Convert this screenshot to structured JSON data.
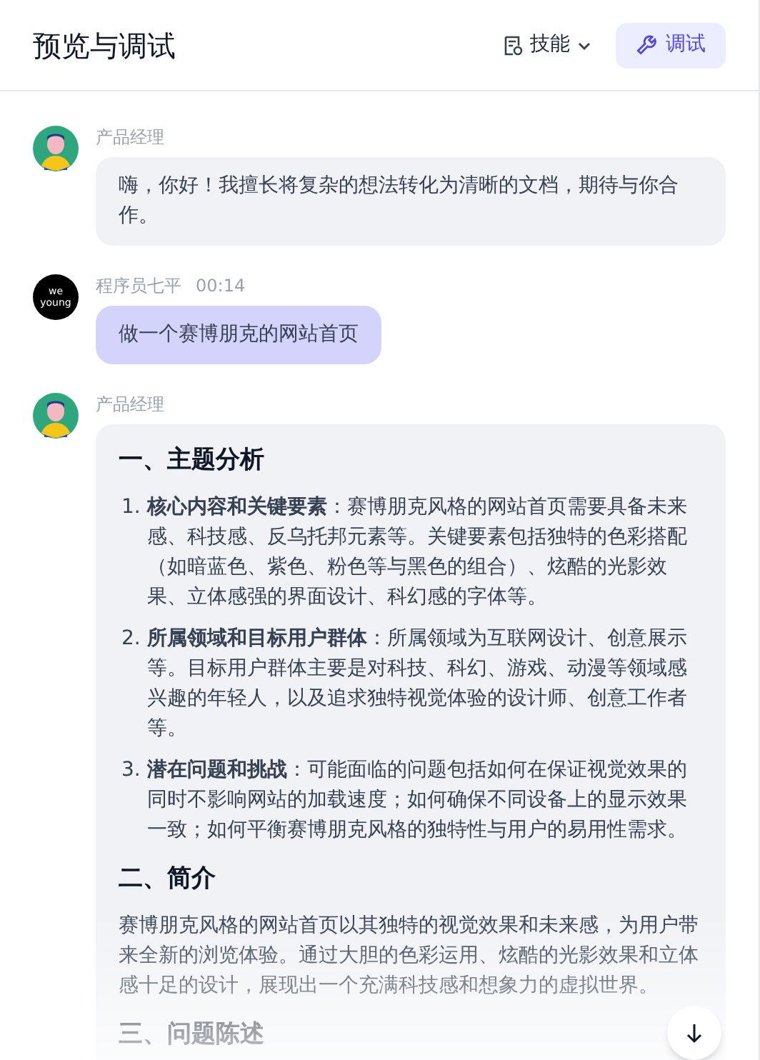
{
  "header": {
    "title": "预览与调试",
    "skills_label": "技能",
    "debug_button": "调试"
  },
  "messages": [
    {
      "kind": "reply",
      "avatar": {
        "kind": "figure"
      },
      "sender": "产品经理",
      "text": "嗨，你好！我擅长将复杂的想法转化为清晰的文档，期待与你合作。"
    },
    {
      "kind": "prompt",
      "avatar": {
        "kind": "badge",
        "text": "we young"
      },
      "sender": "程序员七平",
      "time": "00:14",
      "text": "做一个赛博朋克的网站首页"
    },
    {
      "kind": "document",
      "avatar": {
        "kind": "figure"
      },
      "sender": "产品经理",
      "blocks": [
        {
          "kind": "heading",
          "text": "一、主题分析"
        },
        {
          "kind": "list",
          "items": [
            {
              "number": "1.",
              "text": "**核心内容和关键要素**：赛博朋克风格的网站首页需要具备未来感、科技感、反乌托邦元素等。关键要素包括独特的色彩搭配（如暗蓝色、紫色、粉色等与黑色的组合）、炫酷的光影效果、立体感强的界面设计、科幻感的字体等。"
            },
            {
              "number": "2.",
              "text": "**所属领域和目标用户群体**：所属领域为互联网设计、创意展示等。目标用户群体主要是对科技、科幻、游戏、动漫等领域感兴趣的年轻人，以及追求独特视觉体验的设计师、创意工作者等。"
            },
            {
              "number": "3.",
              "text": "**潜在问题和挑战**：可能面临的问题包括如何在保证视觉效果的同时不影响网站的加载速度；如何确保不同设备上的显示效果一致；如何平衡赛博朋克风格的独特性与用户的易用性需求。"
            }
          ]
        },
        {
          "kind": "heading",
          "text": "二、简介"
        },
        {
          "kind": "paragraph",
          "text": "赛博朋克风格的网站首页以其独特的视觉效果和未来感，为用户带来全新的浏览体验。通过大胆的色彩运用、炫酷的光影效果和立体感十足的设计，展现出一个充满科技感和想象力的虚拟世界。"
        },
        {
          "kind": "heading",
          "text": "三、问题陈述"
        }
      ]
    }
  ]
}
